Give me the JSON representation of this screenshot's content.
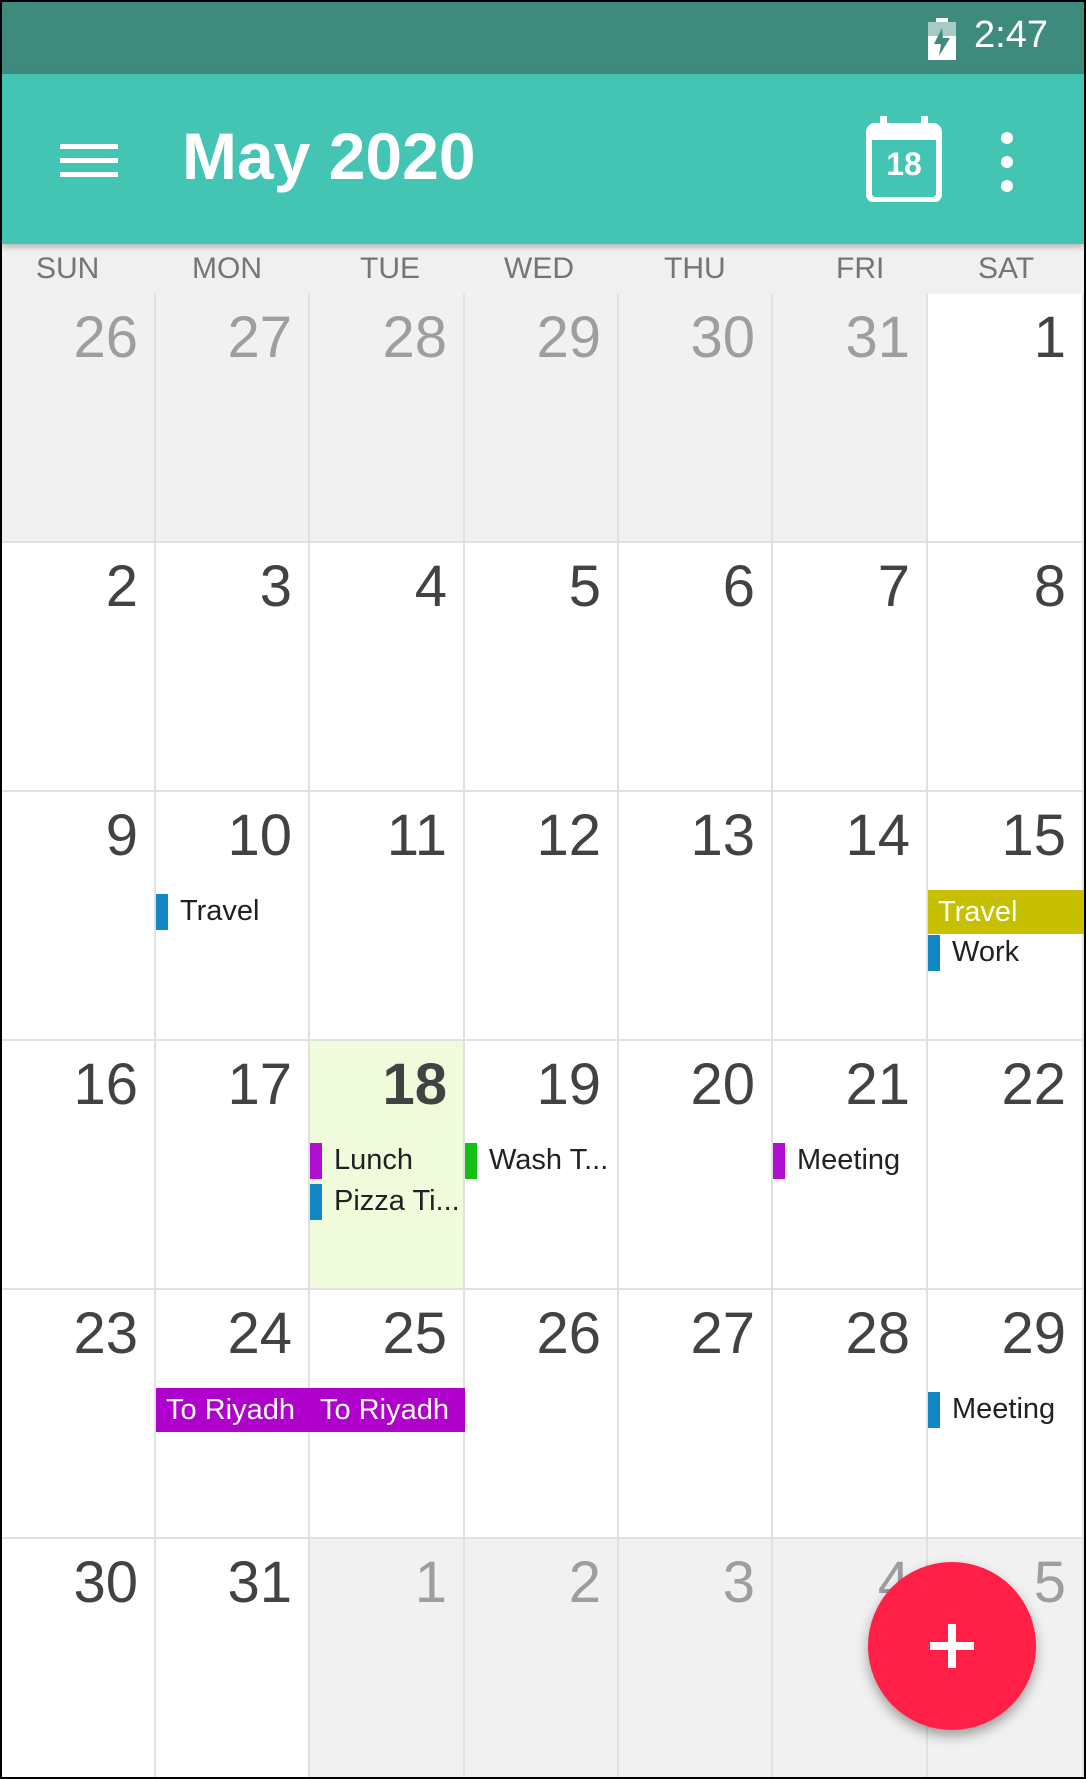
{
  "status_bar": {
    "time": "2:47"
  },
  "app_bar": {
    "title": "May 2020",
    "today_icon_label": "18",
    "icons": [
      "menu-icon",
      "calendar-today-icon",
      "more-vert-icon"
    ]
  },
  "weekdays": [
    "SUN",
    "MON",
    "TUE",
    "WED",
    "THU",
    "FRI",
    "SAT"
  ],
  "weeks": [
    [
      {
        "d": "26",
        "other": true
      },
      {
        "d": "27",
        "other": true
      },
      {
        "d": "28",
        "other": true
      },
      {
        "d": "29",
        "other": true
      },
      {
        "d": "30",
        "other": true
      },
      {
        "d": "31",
        "other": true
      },
      {
        "d": "1"
      }
    ],
    [
      {
        "d": "2"
      },
      {
        "d": "3"
      },
      {
        "d": "4"
      },
      {
        "d": "5"
      },
      {
        "d": "6"
      },
      {
        "d": "7"
      },
      {
        "d": "8"
      }
    ],
    [
      {
        "d": "9"
      },
      {
        "d": "10"
      },
      {
        "d": "11"
      },
      {
        "d": "12"
      },
      {
        "d": "13"
      },
      {
        "d": "14"
      },
      {
        "d": "15"
      }
    ],
    [
      {
        "d": "16"
      },
      {
        "d": "17"
      },
      {
        "d": "18",
        "today": true
      },
      {
        "d": "19"
      },
      {
        "d": "20"
      },
      {
        "d": "21"
      },
      {
        "d": "22"
      }
    ],
    [
      {
        "d": "23"
      },
      {
        "d": "24"
      },
      {
        "d": "25"
      },
      {
        "d": "26"
      },
      {
        "d": "27"
      },
      {
        "d": "28"
      },
      {
        "d": "29"
      }
    ],
    [
      {
        "d": "30"
      },
      {
        "d": "31"
      },
      {
        "d": "1",
        "other": true
      },
      {
        "d": "2",
        "other": true
      },
      {
        "d": "3",
        "other": true
      },
      {
        "d": "4",
        "other": true
      },
      {
        "d": "5",
        "other": true
      }
    ]
  ],
  "events": [
    {
      "week": 2,
      "day": 1,
      "slot": 0,
      "label": "Travel",
      "color": "#1287c3",
      "style": "bar"
    },
    {
      "week": 2,
      "day": 6,
      "slot": 0,
      "label": "Travel",
      "color": "#c6c000",
      "style": "block"
    },
    {
      "week": 2,
      "day": 6,
      "slot": 1,
      "label": "Work",
      "color": "#1287c3",
      "style": "bar"
    },
    {
      "week": 3,
      "day": 2,
      "slot": 0,
      "label": "Lunch",
      "color": "#b10fcf",
      "style": "bar"
    },
    {
      "week": 3,
      "day": 2,
      "slot": 1,
      "label": "Pizza Ti...",
      "color": "#1287c3",
      "style": "bar"
    },
    {
      "week": 3,
      "day": 3,
      "slot": 0,
      "label": "Wash T...",
      "color": "#13c013",
      "style": "bar"
    },
    {
      "week": 3,
      "day": 5,
      "slot": 0,
      "label": "Meeting",
      "color": "#b10fcf",
      "style": "bar"
    },
    {
      "week": 4,
      "day": 1,
      "slot": 0,
      "label": "To Riyadh",
      "color": "#b000cc",
      "style": "block"
    },
    {
      "week": 4,
      "day": 2,
      "slot": 0,
      "label": "To Riyadh",
      "color": "#b000cc",
      "style": "block"
    },
    {
      "week": 4,
      "day": 6,
      "slot": 0,
      "label": "Meeting",
      "color": "#1287c3",
      "style": "bar"
    }
  ],
  "fab": {
    "icon": "plus-icon",
    "color": "#ff1f47"
  }
}
